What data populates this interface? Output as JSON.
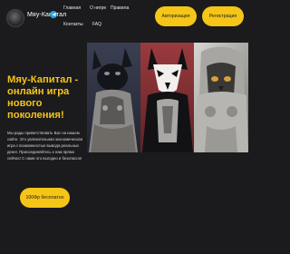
{
  "header": {
    "brand": "Мяу-Капитал",
    "nav": [
      "Главная",
      "О нигре",
      "Правила",
      "Контакты",
      "FAQ"
    ],
    "login_label": "Авторизация",
    "register_label": "Регистрация"
  },
  "hero": {
    "title": "Мяу-Капитал - онлайн игра нового поколения!",
    "text": "Мы рады приветствовать Вас на нашем сайте. Это увлекательная экономическая игра с возможностью вывода реальных денег. Присоединяйтесь к нам прямо сейчас! С нами это выгодно и безопасно!",
    "cta_label": "100Фр бесплатно"
  },
  "colors": {
    "background": "#1b1b1d",
    "accent": "#f5c518",
    "telegram": "#2aa3e0"
  },
  "icons": [
    "logo-icon",
    "telegram-icon"
  ],
  "images": [
    "black-cat-warrior-art",
    "white-mask-cat-warrior-art",
    "silver-cat-knight-art"
  ]
}
